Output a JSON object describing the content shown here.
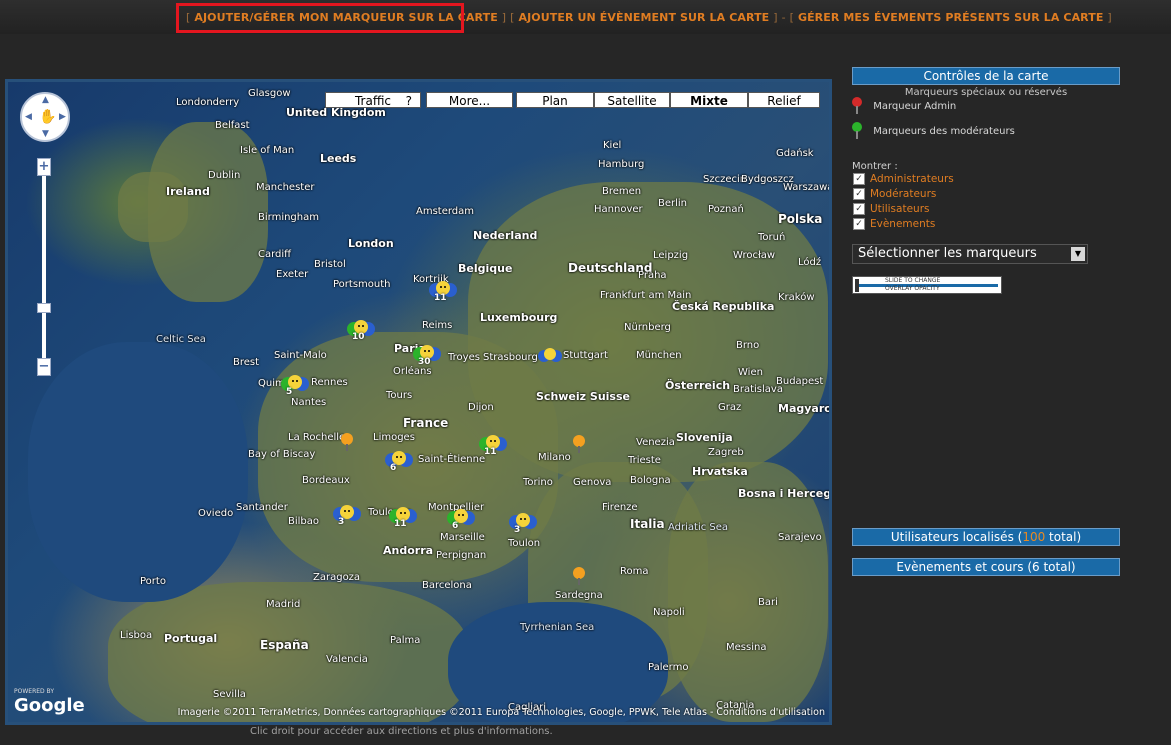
{
  "nav": {
    "bracket_open": "[",
    "bracket_close": "]",
    "dash": "-",
    "link_marker": "AJOUTER/GÉRER MON MARQUEUR SUR LA CARTE",
    "link_event_add": "AJOUTER UN ÉVÈNEMENT SUR LA CARTE",
    "link_event_manage": "GÉRER MES ÉVEMENTS PRÉSENTS SUR LA CARTE"
  },
  "map": {
    "buttons": {
      "traffic": "Traffic",
      "traffic_help": "?",
      "more": "More...",
      "plan": "Plan",
      "satellite": "Satellite",
      "mixte": "Mixte",
      "relief": "Relief"
    },
    "active_type": "Mixte",
    "zoom_level_fraction": 0.2,
    "places": [
      "Glasgow",
      "Londonderry",
      "United Kingdom",
      "Belfast",
      "Isle of Man",
      "Leeds",
      "Ireland",
      "Dublin",
      "Manchester",
      "Birmingham",
      "Cardiff",
      "Bristol",
      "London",
      "Exeter",
      "Portsmouth",
      "Celtic Sea",
      "Brest",
      "Saint-Malo",
      "Rennes",
      "Nantes",
      "Quimper",
      "Amsterdam",
      "Nederland",
      "Belgique",
      "Kortrijk",
      "Luxembourg",
      "Reims",
      "Paris",
      "Orléans",
      "Troyes",
      "Strasbourg",
      "France",
      "Tours",
      "Dijon",
      "Limoges",
      "Saint-Étienne",
      "Bay of Biscay",
      "La Rochelle",
      "Bordeaux",
      "Toulouse",
      "Montpellier",
      "Marseille",
      "Toulon",
      "Deutschland",
      "Hamburg",
      "Bremen",
      "Hannover",
      "Berlin",
      "Leipzig",
      "Frankfurt am Main",
      "Stuttgart",
      "München",
      "Nürnberg",
      "Schweiz Suisse",
      "Milano",
      "Genova",
      "Torino",
      "Bologna",
      "Italia",
      "Roma",
      "Firenze",
      "Venezia",
      "Slovenija",
      "Hrvatska",
      "Česká Republika",
      "Österreich",
      "Wien",
      "Praha",
      "Polska",
      "Warszawa",
      "Szczecin",
      "Poznań",
      "Wrocław",
      "Kraków",
      "Magyarország",
      "Budapest",
      "Bosna i Hercegovina",
      "Sarajevo",
      "Zagreb",
      "Tyrrhenian Sea",
      "Adriatic Sea",
      "Sardegna",
      "Palma",
      "España",
      "Madrid",
      "Barcelona",
      "Valencia",
      "Zaragoza",
      "Bilbao",
      "Andorra",
      "Perpignan",
      "Portugal",
      "Porto",
      "Lisboa",
      "Sevilla",
      "Santander",
      "Oviedo",
      "Gdańsk",
      "Kiel",
      "Bydgoszcz",
      "Lódź",
      "Toruń",
      "Cagliari",
      "Napoli",
      "Palermo",
      "Catania",
      "Messina",
      "Bari",
      "Brno",
      "Bratislava",
      "Graz",
      "Trieste"
    ],
    "clusters": [
      {
        "count": "11"
      },
      {
        "count": "10"
      },
      {
        "count": "30"
      },
      {
        "count": "5"
      },
      {
        "count": "6"
      },
      {
        "count": "11"
      },
      {
        "count": "3"
      },
      {
        "count": "11"
      },
      {
        "count": "6"
      },
      {
        "count": "3"
      }
    ],
    "google_powered": "POWERED BY",
    "google_logo": "Google",
    "attribution": "Imagerie ©2011 TerraMetrics, Données cartographiques ©2011 Europa Technologies, Google, PPWK, Tele Atlas - Conditions d'utilisation",
    "hint": "Clic droit pour accéder aux directions et plus d'informations."
  },
  "panel": {
    "controls_title": "Contrôles de la carte",
    "legend_sub": "Marqueurs spéciaux ou réservés",
    "legend_admin": "Marqueur Admin",
    "legend_mods": "Marqueurs des modérateurs",
    "show_label": "Montrer :",
    "checkboxes": [
      {
        "label": "Administrateurs",
        "checked": true
      },
      {
        "label": "Modérateurs",
        "checked": true
      },
      {
        "label": "Utilisateurs",
        "checked": true
      },
      {
        "label": "Evènements",
        "checked": true
      }
    ],
    "select_value": "Sélectionner les marqueurs",
    "slider_text_1": "SLIDE TO CHANGE",
    "slider_text_2": "OVERLAY OPACITY",
    "users_prefix": "Utilisateurs localisés (",
    "users_count": "100",
    "users_suffix": " total)",
    "events_title": "Evènements et cours (6 total)"
  },
  "colors": {
    "accent": "#e07d22",
    "panel_blue": "#1a6aa7",
    "highlight_red": "#e4161f",
    "admin_pin": "#d42a2a",
    "mod_pin": "#2bb32b"
  }
}
